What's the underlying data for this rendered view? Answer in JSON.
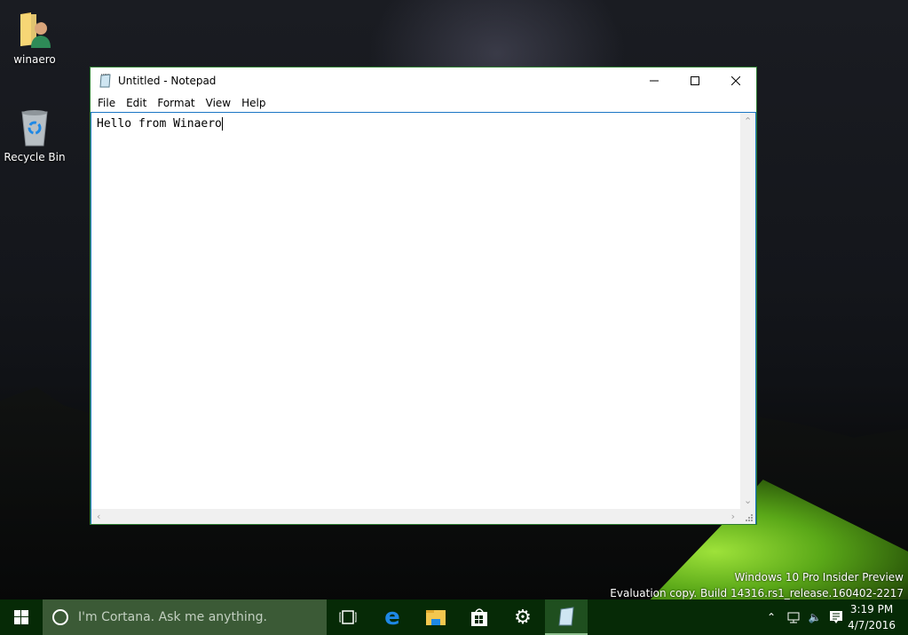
{
  "desktop": {
    "icons": [
      {
        "label": "winaero",
        "icon": "user-folder-icon"
      },
      {
        "label": "Recycle Bin",
        "icon": "recycle-bin-icon"
      }
    ],
    "watermark": {
      "line1": "Windows 10 Pro Insider Preview",
      "line2": "Evaluation copy. Build 14316.rs1_release.160402-2217"
    }
  },
  "window": {
    "title": "Untitled - Notepad",
    "menu": [
      "File",
      "Edit",
      "Format",
      "View",
      "Help"
    ],
    "content": "Hello from Winaero",
    "colors": {
      "border": "#2e7d32",
      "focus": "#1b76c4"
    }
  },
  "taskbar": {
    "search_placeholder": "I'm Cortana. Ask me anything.",
    "apps": [
      "task-view",
      "edge",
      "file-explorer",
      "store",
      "settings",
      "notepad"
    ],
    "active_app": "notepad",
    "clock": {
      "time": "3:19 PM",
      "date": "4/7/2016"
    },
    "colors": {
      "background": "#062a06",
      "search": "#3b5a36",
      "active": "#1f4f1f"
    }
  }
}
